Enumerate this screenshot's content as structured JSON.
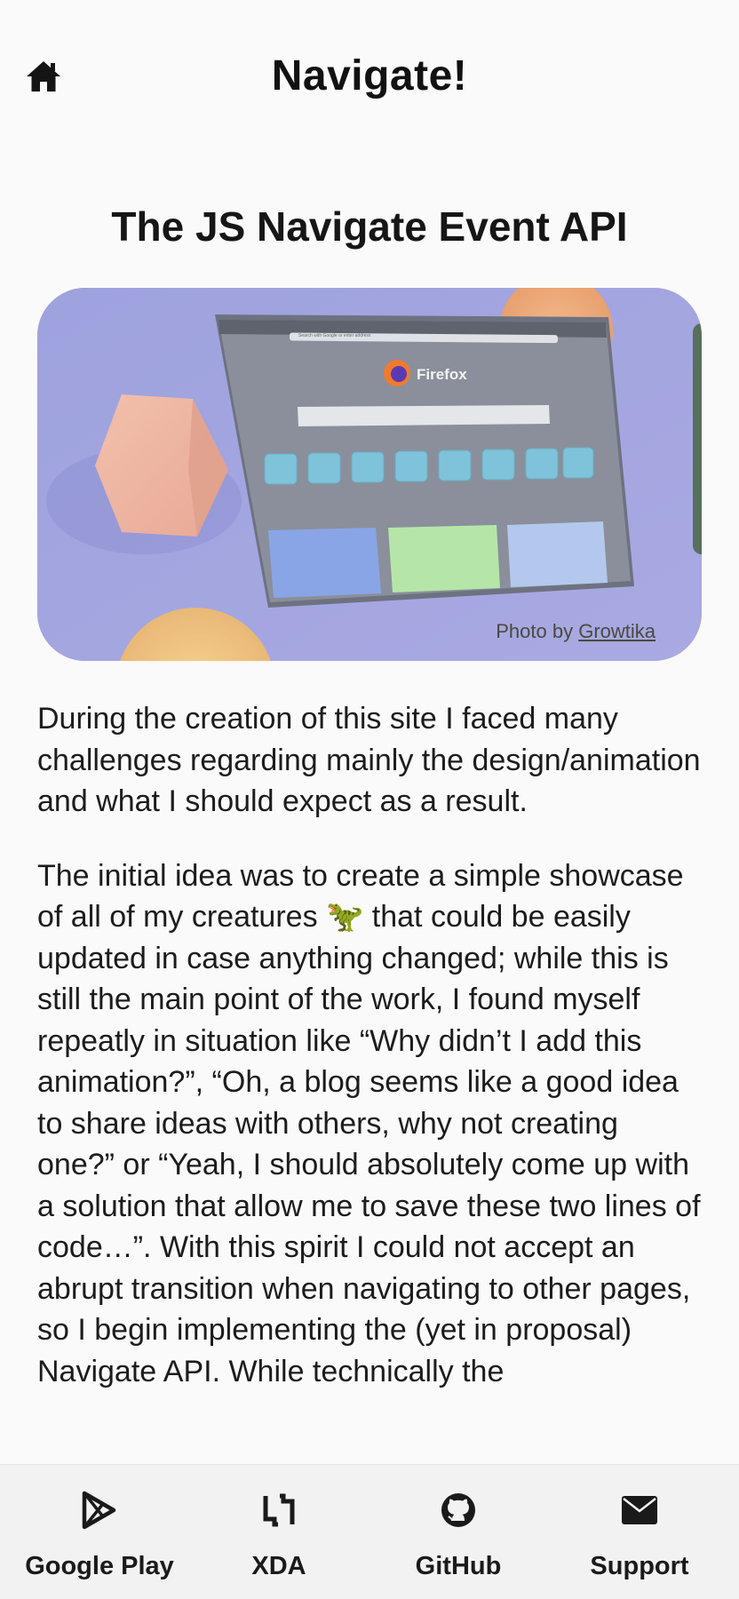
{
  "header": {
    "title": "Navigate!",
    "home_icon": "home-icon"
  },
  "article": {
    "title": "The JS Navigate Event API",
    "hero": {
      "credit_prefix": "Photo by ",
      "credit_author": "Growtika",
      "browser_name": "Firefox",
      "browser_search_placeholder": "Search with Google or enter address"
    },
    "paragraphs": [
      "During the creation of this site I faced many challenges regarding mainly the design/animation and what I should expect as a result.",
      "The initial idea was to create a simple showcase of all of my creatures 🦖 that could be easily updated in case anything changed; while this is still the main point of the work, I found myself repeatly in situation like “Why didn’t I add this animation?”, “Oh, a blog seems like a good idea to share ideas with others, why not creating one?” or “Yeah, I should absolutely come up with a solution that allow me to save these two lines of code…”. With this spirit I could not accept an abrupt transition when navigating to other pages, so I begin implementing the (yet in proposal) Navigate API. While technically the"
    ]
  },
  "bottom_nav": {
    "items": [
      {
        "label": "Google Play",
        "icon": "google-play-icon"
      },
      {
        "label": "XDA",
        "icon": "xda-icon"
      },
      {
        "label": "GitHub",
        "icon": "github-icon"
      },
      {
        "label": "Support",
        "icon": "mail-icon"
      }
    ]
  },
  "colors": {
    "background": "#fafafa",
    "hero_background": "#a3a6e0",
    "text": "#1c1c1c",
    "nav_background": "#f2f2f2"
  }
}
